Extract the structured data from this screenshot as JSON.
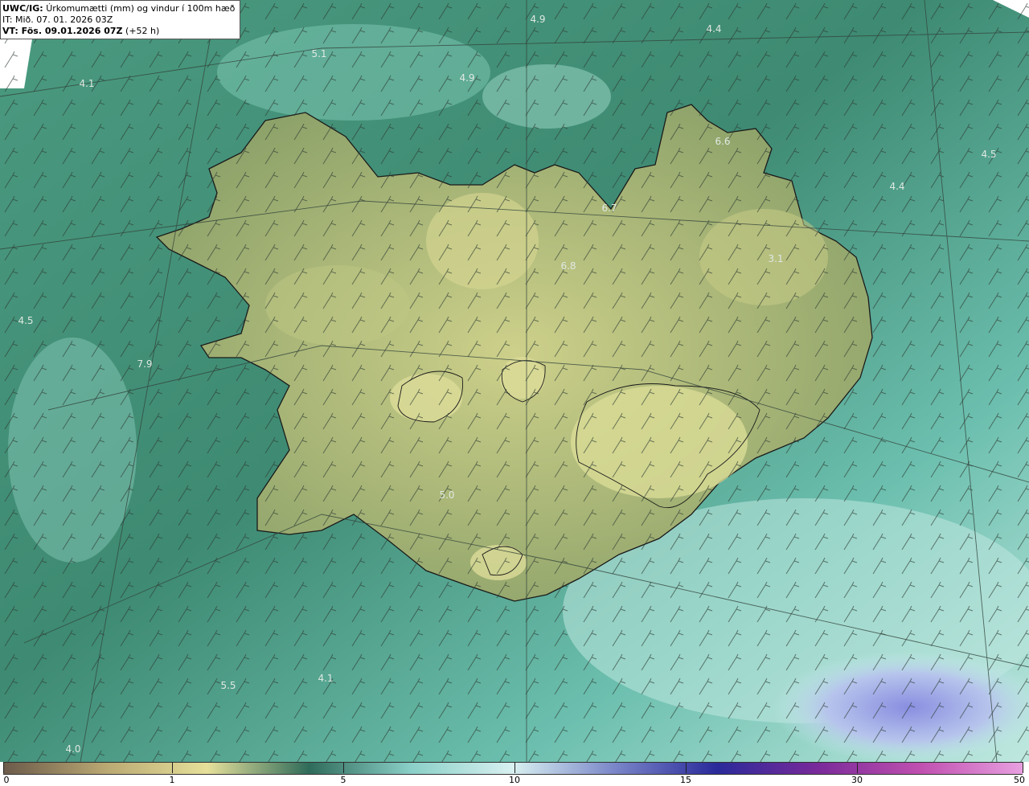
{
  "header": {
    "model": "UWC/IG:",
    "title": "Úrkomumætti (mm) og vindur í 100m hæð",
    "init_time": "IT: Mið. 07. 01. 2026 03Z",
    "valid_prefix": "VT: Fös. 09.01.2026 07Z",
    "valid_suffix": "(+52 h)"
  },
  "map_labels": [
    "4.9",
    "4.4",
    "5.1",
    "4.1",
    "4.9",
    "6.6",
    "4.5",
    "4.4",
    "6.7",
    "3.1",
    "6.8",
    "4.5",
    "7.9",
    "5.0",
    "5.5",
    "4.1",
    "4.0"
  ],
  "colorbar": {
    "ticks": [
      "0",
      "1",
      "5",
      "10",
      "15",
      "30",
      "50"
    ],
    "colors": [
      "#6b5a4a",
      "#b9a872",
      "#e6e09a",
      "#2f6b5a",
      "#8ad0c8",
      "#d8f0f0",
      "#7a86c8",
      "#2a2a9a",
      "#7a2a9a",
      "#c050b0",
      "#e8a0e0"
    ]
  },
  "map_colors": {
    "sea_dark": "#3e8a72",
    "sea_light": "#8fd2c2",
    "land": "#9fae6a",
    "highland": "#cfd08a",
    "coast": "#1a1a1a"
  }
}
